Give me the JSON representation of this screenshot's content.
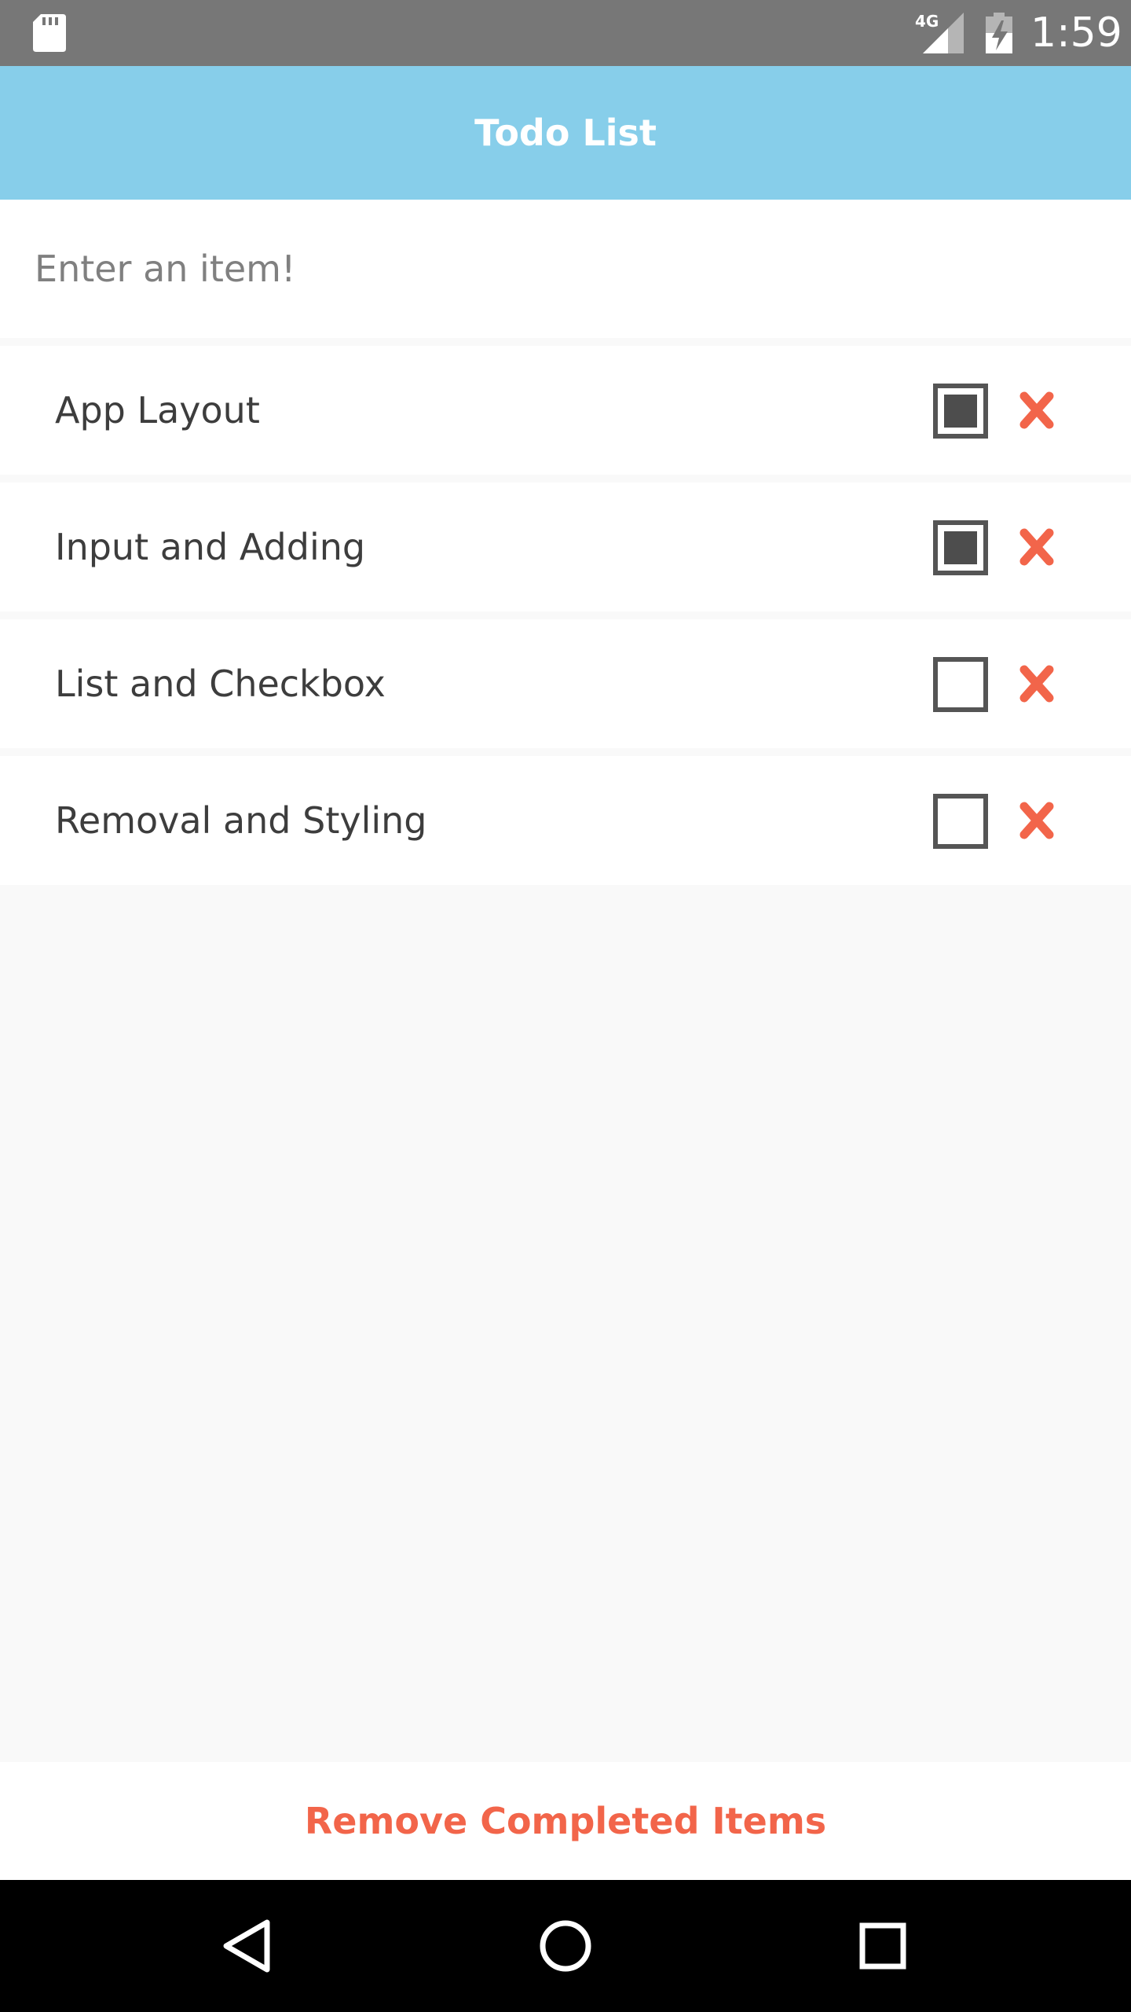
{
  "status_bar": {
    "network": "4G",
    "time": "1:59",
    "icons": [
      "sd-card-icon",
      "signal-icon",
      "battery-charging-icon"
    ]
  },
  "app_bar": {
    "title": "Todo List"
  },
  "input": {
    "placeholder": "Enter an item!",
    "value": ""
  },
  "todos": [
    {
      "label": "App Layout",
      "checked": true
    },
    {
      "label": "Input and Adding",
      "checked": true
    },
    {
      "label": "List and Checkbox",
      "checked": false
    },
    {
      "label": "Removal and Styling",
      "checked": false
    }
  ],
  "footer": {
    "remove_completed_label": "Remove Completed Items"
  },
  "nav_bar": {
    "icons": [
      "back-icon",
      "home-icon",
      "recents-icon"
    ]
  },
  "colors": {
    "status_bar": "#777777",
    "app_bar": "#87ceea",
    "accent": "#f2654a",
    "background": "#f9f9f9",
    "checkbox": "#555555"
  }
}
